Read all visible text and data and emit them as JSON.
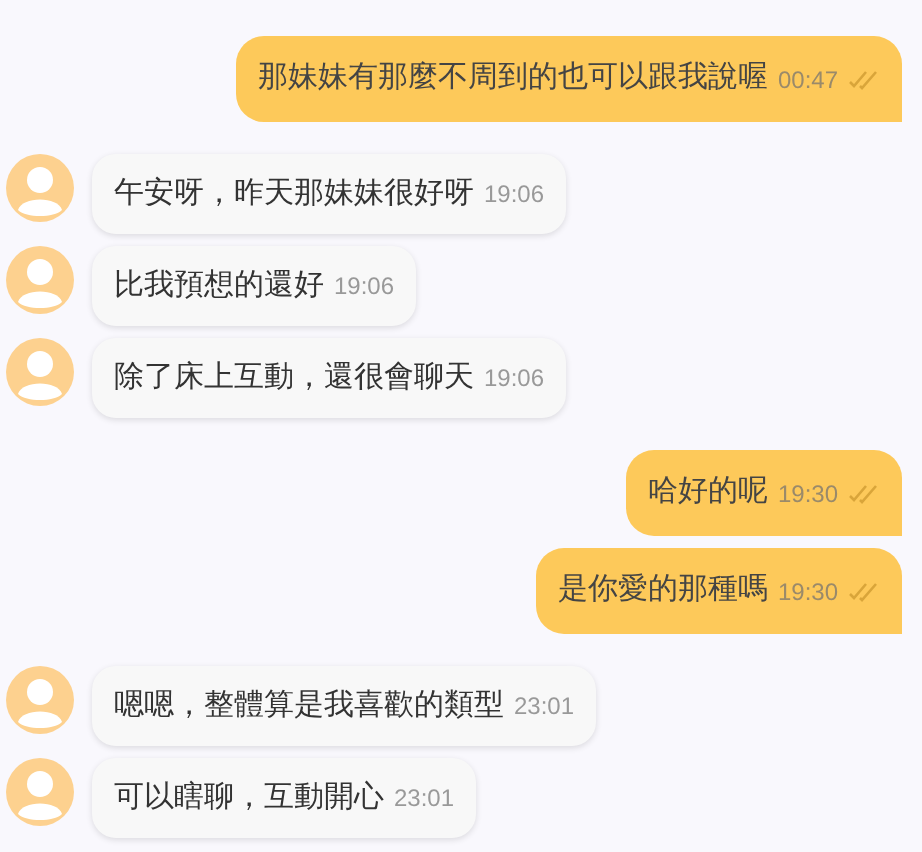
{
  "messages": [
    {
      "kind": "out",
      "text": "那妹妹有那麼不周到的也可以跟我說喔",
      "time": "00:47",
      "read": true
    },
    {
      "kind": "in",
      "text": "午安呀，昨天那妹妹很好呀",
      "time": "19:06"
    },
    {
      "kind": "in",
      "text": "比我預想的還好",
      "time": "19:06"
    },
    {
      "kind": "in",
      "text": "除了床上互動，還很會聊天",
      "time": "19:06"
    },
    {
      "kind": "out",
      "text": "哈好的呢",
      "time": "19:30",
      "read": true
    },
    {
      "kind": "out",
      "text": "是你愛的那種嗎",
      "time": "19:30",
      "read": true
    },
    {
      "kind": "in",
      "text": "嗯嗯，整體算是我喜歡的類型",
      "time": "23:01"
    },
    {
      "kind": "in",
      "text": "可以瞎聊，互動開心",
      "time": "23:01"
    }
  ]
}
